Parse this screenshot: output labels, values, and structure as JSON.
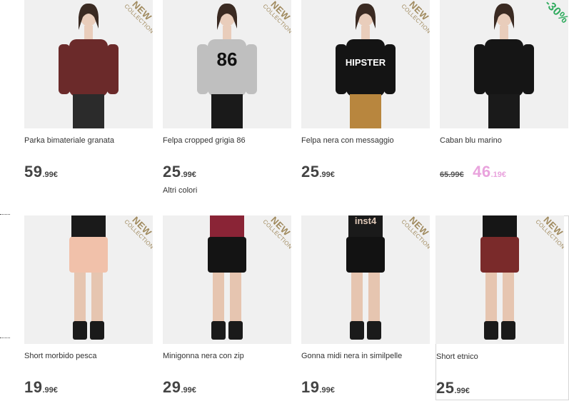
{
  "products": [
    {
      "name": "Parka bimateriale granata",
      "price_int": "59",
      "price_dec": ".99€",
      "badge_main": "NEW",
      "badge_sub": "COLLECTION*",
      "colors": {
        "top": "#6b2a2a",
        "bottom": "#2b2b2b",
        "accent": "#8fa3b8"
      }
    },
    {
      "name": "Felpa cropped grigia 86",
      "price_int": "25",
      "price_dec": ".99€",
      "extra": "Altri colori",
      "badge_main": "NEW",
      "badge_sub": "COLLECTION*",
      "print_text": "86",
      "colors": {
        "top": "#bfbfbf",
        "bottom": "#1a1a1a",
        "accent": "#111111"
      }
    },
    {
      "name": "Felpa nera con messaggio",
      "price_int": "25",
      "price_dec": ".99€",
      "badge_main": "NEW",
      "badge_sub": "COLLECTION*",
      "print_text": "HIPSTER",
      "colors": {
        "top": "#141414",
        "bottom": "#b8863e",
        "accent": "#ffffff"
      }
    },
    {
      "name": "Caban blu marino",
      "old_price": "65.99€",
      "price_int": "46",
      "price_dec": ".19€",
      "badge_main": "-30%",
      "colors": {
        "top": "#151515",
        "bottom": "#1a1a1a",
        "accent": "#f2f2f2"
      }
    },
    {
      "name": "Short morbido pesca",
      "price_int": "19",
      "price_dec": ".99€",
      "badge_main": "NEW",
      "badge_sub": "COLLECTION*",
      "colors": {
        "top": "#1a1a1a",
        "bottom": "#f1c1aa",
        "accent": "#e8cbb8"
      }
    },
    {
      "name": "Minigonna nera con zip",
      "price_int": "29",
      "price_dec": ".99€",
      "badge_main": "NEW",
      "badge_sub": "COLLECTION*",
      "colors": {
        "top": "#8a2436",
        "bottom": "#141414",
        "accent": "#e0c9b8"
      }
    },
    {
      "name": "Gonna midi nera in similpelle",
      "price_int": "19",
      "price_dec": ".99€",
      "badge_main": "NEW",
      "badge_sub": "COLLECTION*",
      "print_text": "inst4",
      "colors": {
        "top": "#1a1a1a",
        "bottom": "#121212",
        "accent": "#e0c9b8"
      }
    },
    {
      "name": "Short etnico",
      "price_int": "25",
      "price_dec": ".99€",
      "badge_main": "NEW",
      "badge_sub": "COLLECTION*",
      "colors": {
        "top": "#161616",
        "bottom": "#7a2a2a",
        "accent": "#e0c9b8"
      }
    }
  ]
}
